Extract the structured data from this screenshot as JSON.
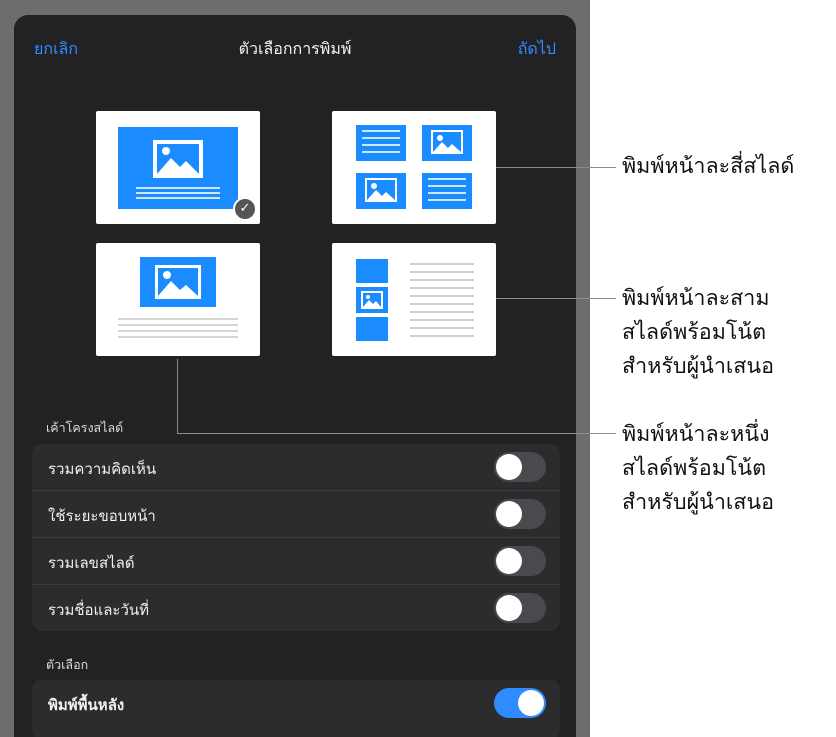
{
  "nav": {
    "cancel": "ยกเลิก",
    "title": "ตัวเลือกการพิมพ์",
    "next": "ถัดไป"
  },
  "layout_section": {
    "title": "เค้าโครงสไลด์",
    "selected_layout": "single-slide"
  },
  "options_list": [
    {
      "label": "รวมความคิดเห็น",
      "on": false
    },
    {
      "label": "ใช้ระยะขอบหน้า",
      "on": false
    },
    {
      "label": "รวมเลขสไลด์",
      "on": false
    },
    {
      "label": "รวมชื่อและวันที่",
      "on": false
    }
  ],
  "options_section": {
    "title": "ตัวเลือก"
  },
  "background_option": {
    "label": "พิมพ์พื้นหลัง",
    "on": true
  },
  "callouts": {
    "four": [
      "พิมพ์หน้าละสี่สไลด์"
    ],
    "three": [
      "พิมพ์หน้าละสาม",
      "สไลด์พร้อมโน้ต",
      "สำหรับผู้นำเสนอ"
    ],
    "one": [
      "พิมพ์หน้าละหนึ่ง",
      "สไลด์พร้อมโน้ต",
      "สำหรับผู้นำเสนอ"
    ]
  },
  "colors": {
    "accent": "#2f8bff",
    "slide_blue": "#1a8cff",
    "panel": "#222224",
    "backdrop": "#6b6e6b"
  },
  "icons": [
    "checkmark-icon",
    "image-icon"
  ]
}
